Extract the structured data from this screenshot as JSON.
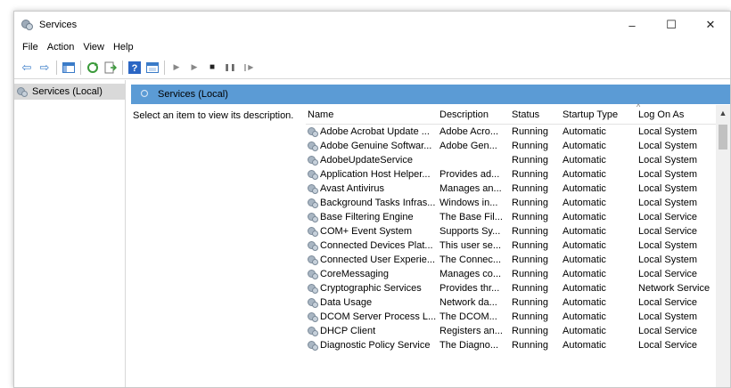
{
  "window": {
    "title": "Services",
    "controls": {
      "minimize": "–",
      "maximize": "☐",
      "close": "✕"
    }
  },
  "menu": [
    "File",
    "Action",
    "View",
    "Help"
  ],
  "toolbar": {
    "back": "⇦",
    "forward": "⇨",
    "play": "▶",
    "play2": "▶",
    "stop": "■",
    "pause": "❚❚",
    "resume": "❙▶"
  },
  "tree": {
    "root": "Services (Local)"
  },
  "panel": {
    "title": "Services (Local)",
    "description": "Select an item to view its description."
  },
  "columns": {
    "name": "Name",
    "description": "Description",
    "status": "Status",
    "startup": "Startup Type",
    "logon": "Log On As"
  },
  "services": [
    {
      "name": "Adobe Acrobat Update ...",
      "description": "Adobe Acro...",
      "status": "Running",
      "startup": "Automatic",
      "logon": "Local System"
    },
    {
      "name": "Adobe Genuine Softwar...",
      "description": "Adobe Gen...",
      "status": "Running",
      "startup": "Automatic",
      "logon": "Local System"
    },
    {
      "name": "AdobeUpdateService",
      "description": "",
      "status": "Running",
      "startup": "Automatic",
      "logon": "Local System"
    },
    {
      "name": "Application Host Helper...",
      "description": "Provides ad...",
      "status": "Running",
      "startup": "Automatic",
      "logon": "Local System"
    },
    {
      "name": "Avast Antivirus",
      "description": "Manages an...",
      "status": "Running",
      "startup": "Automatic",
      "logon": "Local System"
    },
    {
      "name": "Background Tasks Infras...",
      "description": "Windows in...",
      "status": "Running",
      "startup": "Automatic",
      "logon": "Local System"
    },
    {
      "name": "Base Filtering Engine",
      "description": "The Base Fil...",
      "status": "Running",
      "startup": "Automatic",
      "logon": "Local Service"
    },
    {
      "name": "COM+ Event System",
      "description": "Supports Sy...",
      "status": "Running",
      "startup": "Automatic",
      "logon": "Local Service"
    },
    {
      "name": "Connected Devices Plat...",
      "description": "This user se...",
      "status": "Running",
      "startup": "Automatic",
      "logon": "Local System"
    },
    {
      "name": "Connected User Experie...",
      "description": "The Connec...",
      "status": "Running",
      "startup": "Automatic",
      "logon": "Local System"
    },
    {
      "name": "CoreMessaging",
      "description": "Manages co...",
      "status": "Running",
      "startup": "Automatic",
      "logon": "Local Service"
    },
    {
      "name": "Cryptographic Services",
      "description": "Provides thr...",
      "status": "Running",
      "startup": "Automatic",
      "logon": "Network Service"
    },
    {
      "name": "Data Usage",
      "description": "Network da...",
      "status": "Running",
      "startup": "Automatic",
      "logon": "Local Service"
    },
    {
      "name": "DCOM Server Process L...",
      "description": "The DCOM...",
      "status": "Running",
      "startup": "Automatic",
      "logon": "Local System"
    },
    {
      "name": "DHCP Client",
      "description": "Registers an...",
      "status": "Running",
      "startup": "Automatic",
      "logon": "Local Service"
    },
    {
      "name": "Diagnostic Policy Service",
      "description": "The Diagno...",
      "status": "Running",
      "startup": "Automatic",
      "logon": "Local Service"
    }
  ],
  "colors": {
    "accent_header": "#5b9bd5",
    "tree_selected": "#d9d9d9"
  },
  "icons": {
    "service": "service-gear-icon",
    "help": "help-icon",
    "sort": "sort-caret-icon"
  }
}
